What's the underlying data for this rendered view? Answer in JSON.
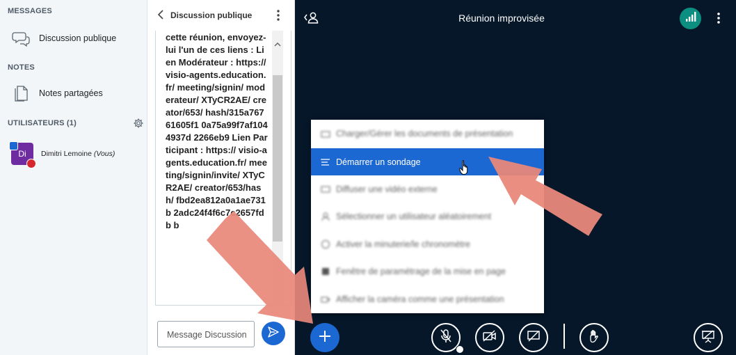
{
  "sidebar": {
    "messages_title": "MESSAGES",
    "public_chat_label": "Discussion publique",
    "notes_title": "NOTES",
    "shared_notes_label": "Notes partagées",
    "users_title": "UTILISATEURS (1)",
    "user": {
      "initials": "Di",
      "name": "Dimitri Lemoine",
      "suffix": "(Vous)"
    }
  },
  "chat": {
    "title": "Discussion publique",
    "message": "cette réunion, envoyez-lui l'un de ces liens : Lien Modérateur : https://visio-agents.education.fr/ meeting/signin/ moderateur/ XTyCR2AE/ creator/653/ hash/315a76761605f1 0a75a99f7af1044937d 2266eb9 Lien Participant : https:// visio-agents.education.fr/ meeting/signin/invite/ XTyCR2AE/ creator/653/hash/ fbd2ea812a0a1ae731b 2adc24f4f6c7c2657fdb b",
    "input_placeholder": "Message Discussion"
  },
  "main": {
    "meeting_title": "Réunion improvisée",
    "action_menu": [
      {
        "label": "Charger/Gérer les documents de présentation",
        "icon": "upload-icon",
        "state": "blurred"
      },
      {
        "label": "Démarrer un sondage",
        "icon": "poll-icon",
        "state": "highlighted"
      },
      {
        "label": "Diffuser une vidéo externe",
        "icon": "video-icon",
        "state": "blurred"
      },
      {
        "label": "Sélectionner un utilisateur aléatoirement",
        "icon": "user-icon",
        "state": "blurred"
      },
      {
        "label": "Activer la minuterie/le chronomètre",
        "icon": "timer-icon",
        "state": "blurred"
      },
      {
        "label": "Fenêtre de paramétrage de la mise en page",
        "icon": "layout-icon",
        "state": "blurred"
      },
      {
        "label": "Afficher la caméra comme une présentation",
        "icon": "camera-icon",
        "state": "blurred"
      }
    ]
  },
  "colors": {
    "accent": "#1c68d3",
    "main_bg": "#06172a",
    "sidebar_bg": "#f3f6f9",
    "connection": "#0c8f80",
    "avatar": "#6f2ca0",
    "annotation_arrow": "#e8887a"
  }
}
